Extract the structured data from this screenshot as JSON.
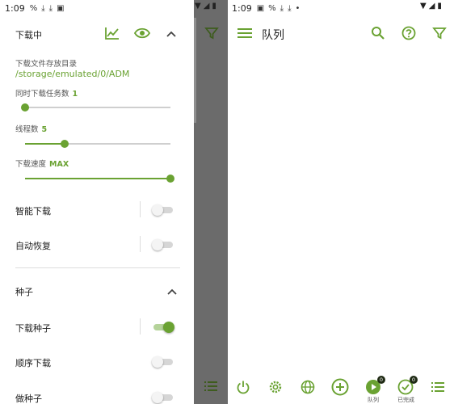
{
  "status_left": {
    "time": "1:09",
    "icons": [
      "%",
      "download-icon",
      "download-icon",
      "image-icon"
    ]
  },
  "status_right": {
    "time": "1:09",
    "icons": [
      "image-icon",
      "%",
      "download-icon",
      "download-icon",
      "dot"
    ]
  },
  "drawer": {
    "downloading": {
      "title": "下载中",
      "save_dir_label": "下载文件存放目录",
      "save_dir_path": "/storage/emulated/0/ADM",
      "concurrent_label": "同时下载任务数",
      "concurrent_value": "1",
      "concurrent_level": 0.0,
      "threads_label": "线程数",
      "threads_value": "5",
      "threads_level": 0.27,
      "speed_label": "下载速度",
      "speed_value": "MAX",
      "speed_level": 1.0,
      "smart_download": "智能下载",
      "smart_download_on": false,
      "auto_resume": "自动恢复",
      "auto_resume_on": false
    },
    "torrent": {
      "title": "种子",
      "download_torrent": "下载种子",
      "download_torrent_on": true,
      "sequential": "顺序下载",
      "sequential_on": false,
      "seeding": "做种子",
      "seeding_on": false
    }
  },
  "appbar": {
    "title": "队列"
  },
  "bottom_nav": {
    "queue_label": "队列",
    "queue_badge": "0",
    "done_label": "已完成",
    "done_badge": "0"
  },
  "colors": {
    "accent": "#6aa232",
    "scrim": "#6b6b6b"
  }
}
